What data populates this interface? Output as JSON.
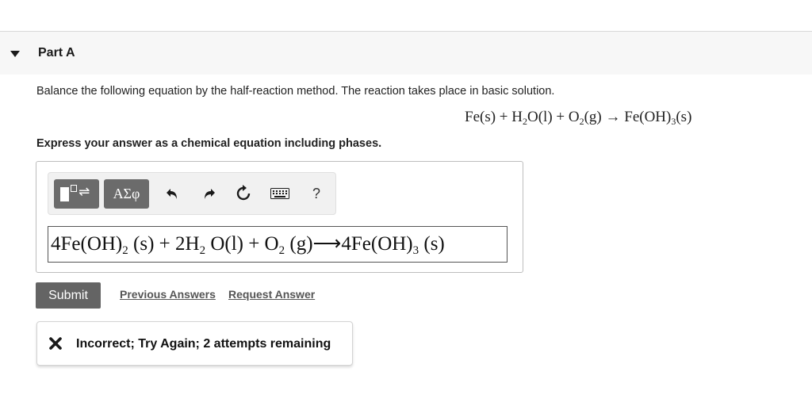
{
  "part": {
    "title": "Part A",
    "instructions": "Balance the following equation by the half-reaction method. The reaction takes place in basic solution.",
    "equation": {
      "reactant1": "Fe(s) + H",
      "reactant1_sub": "2",
      "reactant2": "O(l) + O",
      "reactant2_sub": "2",
      "reactant3": "(g) → Fe(OH)",
      "product_sub": "3",
      "product_phase": "(s)"
    },
    "prompt": "Express your answer as a chemical equation including phases."
  },
  "toolbar": {
    "templates_icon": "templates-icon",
    "greek_label": "ΑΣφ",
    "undo_icon": "undo-icon",
    "redo_icon": "redo-icon",
    "reset_icon": "reset-icon",
    "keyboard_icon": "keyboard-icon",
    "help_label": "?"
  },
  "answer": {
    "part1": "4Fe(OH)",
    "sub1": "2",
    "part2": " (s) + 2H",
    "sub2": "2",
    "part3": " O(l) + O",
    "sub3": "2",
    "part4": " (g)⟶4Fe(OH)",
    "sub4": "3",
    "part5": " (s)"
  },
  "actions": {
    "submit_label": "Submit",
    "previous_answers_label": "Previous Answers",
    "request_answer_label": "Request Answer"
  },
  "feedback": {
    "icon": "x-icon",
    "text": "Incorrect; Try Again; 2 attempts remaining"
  }
}
